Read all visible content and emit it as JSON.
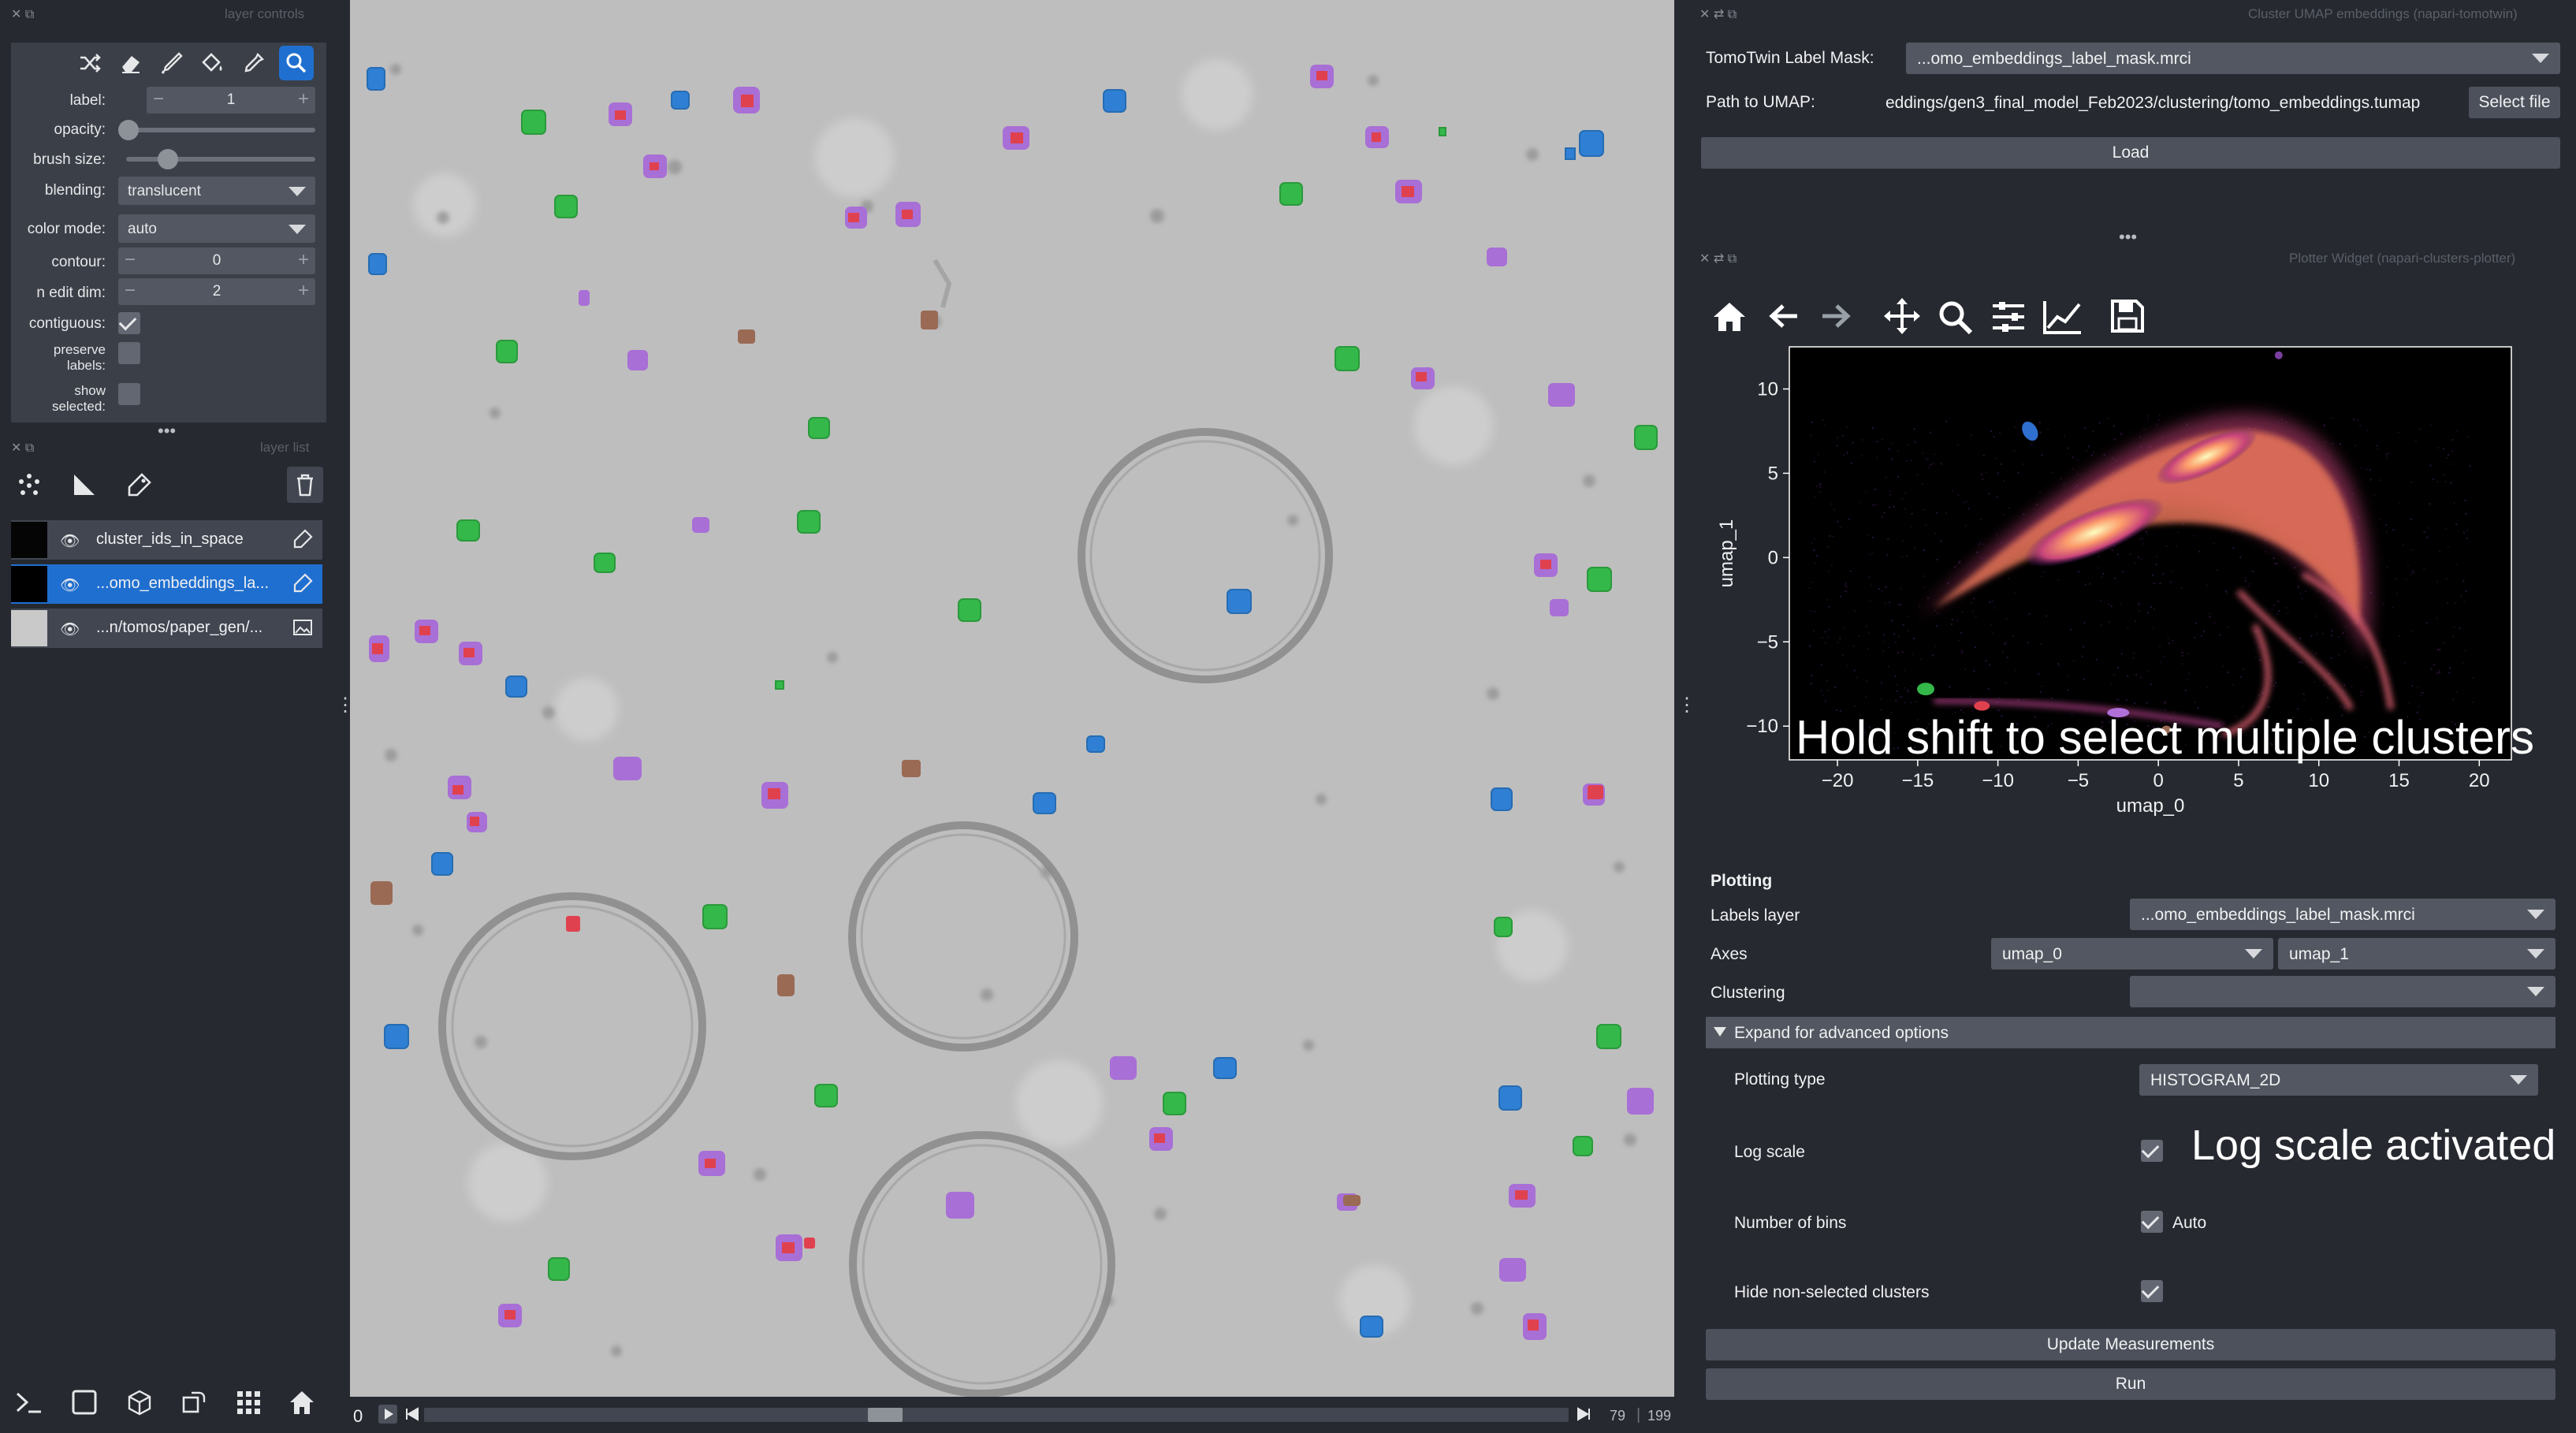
{
  "layer_controls": {
    "title": "layer controls",
    "label_label": "label:",
    "label_value": "1",
    "opacity_label": "opacity:",
    "opacity_value": 0.0,
    "brush_size_label": "brush size:",
    "brush_size_value": 0.18,
    "blending_label": "blending:",
    "blending_value": "translucent",
    "color_mode_label": "color mode:",
    "color_mode_value": "auto",
    "contour_label": "contour:",
    "contour_value": "0",
    "n_edit_dim_label": "n edit dim:",
    "n_edit_dim_value": "2",
    "contiguous_label": "contiguous:",
    "contiguous_checked": true,
    "preserve_label_1": "preserve",
    "preserve_label_2": "labels:",
    "preserve_checked": false,
    "show_label_1": "show",
    "show_label_2": "selected:",
    "show_checked": false,
    "tools": [
      "shuffle-icon",
      "eraser-icon",
      "paintbrush-icon",
      "fill-bucket-icon",
      "color-picker-icon",
      "zoom-icon"
    ]
  },
  "layer_list": {
    "title": "layer list",
    "layers": [
      {
        "name": "cluster_ids_in_space",
        "selected": false
      },
      {
        "name": "...omo_embeddings_la...",
        "selected": true
      },
      {
        "name": "...n/tomos/paper_gen/...",
        "selected": false
      }
    ]
  },
  "viewer": {
    "frame_start": "0",
    "current_frame": "79",
    "total_frames": "199",
    "slider_position": 0.4
  },
  "umap_widget": {
    "title": "Cluster UMAP embeddings (napari-tomotwin)",
    "label_mask_label": "TomoTwin Label Mask:",
    "label_mask_value": "...omo_embeddings_label_mask.mrci",
    "path_label": "Path to UMAP:",
    "path_value": "eddings/gen3_final_model_Feb2023/clustering/tomo_embeddings.tumap",
    "select_file": "Select file",
    "load": "Load"
  },
  "plotter_widget": {
    "title": "Plotter Widget (napari-clusters-plotter)",
    "toolbar": [
      "home-icon",
      "back-arrow-icon",
      "forward-arrow-icon",
      "pan-icon",
      "zoom-icon",
      "configure-subplots-icon",
      "axes-edit-icon",
      "save-icon"
    ],
    "plotting_header": "Plotting",
    "labels_layer_label": "Labels layer",
    "labels_layer_value": "...omo_embeddings_label_mask.mrci",
    "axes_label": "Axes",
    "axes_x": "umap_0",
    "axes_y": "umap_1",
    "clustering_label": "Clustering",
    "clustering_value": "",
    "expand_label": "Expand for advanced options",
    "plotting_type_label": "Plotting type",
    "plotting_type_value": "HISTOGRAM_2D",
    "log_scale_label": "Log scale",
    "log_scale_checked": true,
    "log_scale_annotation": "Log scale activated",
    "bins_label": "Number of bins",
    "bins_auto_label": "Auto",
    "bins_auto_checked": true,
    "hide_label": "Hide non-selected clusters",
    "hide_checked": true,
    "update_button": "Update Measurements",
    "run_button": "Run"
  },
  "chart_data": {
    "type": "heatmap",
    "xlabel": "umap_0",
    "ylabel": "umap_1",
    "xlim": [
      -23,
      22
    ],
    "ylim": [
      -12,
      12.5
    ],
    "xticks": [
      -20,
      -15,
      -10,
      -5,
      0,
      5,
      10,
      15,
      20
    ],
    "yticks": [
      10,
      5,
      0,
      -5,
      -10
    ],
    "annotation": "Hold shift to select multiple clusters",
    "colormap": "magma",
    "background": "#000000"
  },
  "colors": {
    "app_bg": "#262930",
    "panel_bg": "#3b3f48",
    "accent": "#1f6fd0",
    "cluster_red": "#e0414f",
    "cluster_green": "#35b84a",
    "cluster_blue": "#2f80d4",
    "cluster_purple": "#a86fd6",
    "cluster_brown": "#9a6a55"
  }
}
